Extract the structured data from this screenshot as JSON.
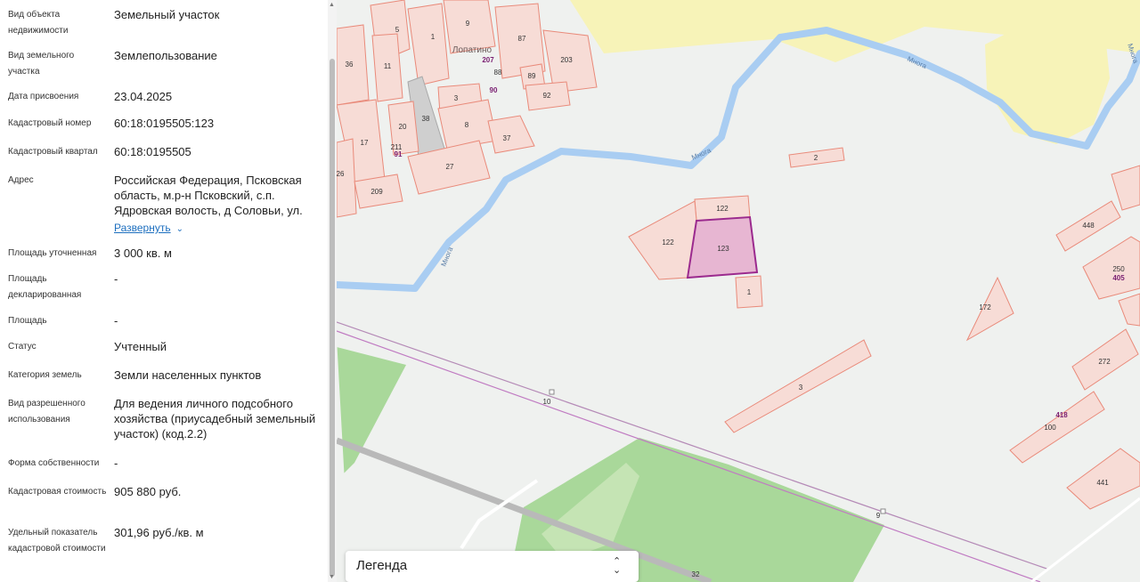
{
  "details": {
    "rows": [
      {
        "label": "Вид объекта недвижимости",
        "value": "Земельный участок"
      },
      {
        "label": "Вид земельного участка",
        "value": "Землепользование"
      },
      {
        "label": "Дата присвоения",
        "value": "23.04.2025"
      },
      {
        "label": "Кадастровый номер",
        "value": "60:18:0195505:123"
      },
      {
        "label": "Кадастровый квартал",
        "value": "60:18:0195505"
      },
      {
        "label": "Адрес",
        "value": "Российская Федерация, Псковская область, м.р-н Псковский, с.п. Ядровская волость, д Соловьи, ул."
      },
      {
        "label": "Площадь уточненная",
        "value": "3 000 кв. м"
      },
      {
        "label": "Площадь декларированная",
        "value": "-"
      },
      {
        "label": "Площадь",
        "value": "-"
      },
      {
        "label": "Статус",
        "value": "Учтенный"
      },
      {
        "label": "Категория земель",
        "value": "Земли населенных пунктов"
      },
      {
        "label": "Вид разрешенного использования",
        "value": "Для ведения личного подсобного хозяйства (приусадебный земельный участок) (код.2.2)"
      },
      {
        "label": "Форма собственности",
        "value": "-"
      },
      {
        "label": "Кадастровая стоимость",
        "value": "905 880 руб."
      },
      {
        "label": "Удельный показатель кадастровой стоимости",
        "value": "301,96 руб./кв. м"
      }
    ],
    "expand_label": "Развернуть"
  },
  "map": {
    "place_name": "Лопатино",
    "river_name": "Многа",
    "lots": [
      "5",
      "1",
      "9",
      "87",
      "203",
      "36",
      "11",
      "207",
      "88",
      "89",
      "90",
      "92",
      "3",
      "38",
      "20",
      "8",
      "37",
      "17",
      "211",
      "91",
      "27",
      "26",
      "209",
      "2",
      "122",
      "122",
      "123",
      "1",
      "448",
      "250",
      "405",
      "172",
      "3",
      "272",
      "10",
      "418",
      "100",
      "441",
      "9",
      "32"
    ],
    "colors": {
      "selected_fill": "#e7b6d2",
      "selected_stroke": "#9b2a8e",
      "lot_fill": "#f7dcd6",
      "lot_stroke": "#e98a7a",
      "river": "#a9cdf2",
      "forest": "#a9d89a",
      "field": "#f7f3b8"
    }
  },
  "legend": {
    "title": "Легенда"
  }
}
